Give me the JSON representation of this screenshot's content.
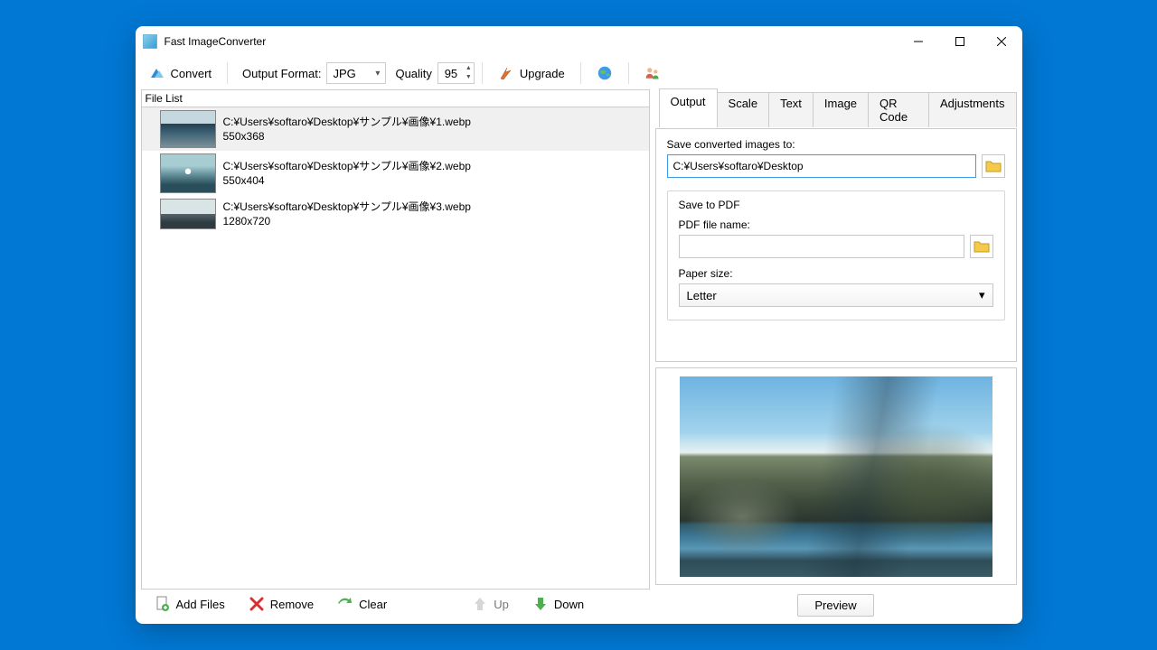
{
  "titlebar": {
    "title": "Fast ImageConverter"
  },
  "toolbar": {
    "convert_label": "Convert",
    "output_format_label": "Output Format:",
    "output_format_value": "JPG",
    "quality_label": "Quality",
    "quality_value": "95",
    "upgrade_label": "Upgrade"
  },
  "filelist": {
    "header": "File List",
    "items": [
      {
        "path": "C:¥Users¥softaro¥Desktop¥サンプル¥画像¥1.webp",
        "dims": "550x368",
        "selected": true
      },
      {
        "path": "C:¥Users¥softaro¥Desktop¥サンプル¥画像¥2.webp",
        "dims": "550x404",
        "selected": false
      },
      {
        "path": "C:¥Users¥softaro¥Desktop¥サンプル¥画像¥3.webp",
        "dims": "1280x720",
        "selected": false
      }
    ]
  },
  "bottombar": {
    "add_files": "Add Files",
    "remove": "Remove",
    "clear": "Clear",
    "up": "Up",
    "down": "Down"
  },
  "tabs": {
    "items": [
      "Output",
      "Scale",
      "Text",
      "Image",
      "QR Code",
      "Adjustments"
    ],
    "active": 0
  },
  "output": {
    "save_to_label": "Save converted images to:",
    "save_to_value": "C:¥Users¥softaro¥Desktop",
    "save_to_pdf_label": "Save to PDF",
    "pdf_filename_label": "PDF file name:",
    "pdf_filename_value": "",
    "paper_size_label": "Paper size:",
    "paper_size_value": "Letter"
  },
  "preview": {
    "button_label": "Preview"
  }
}
